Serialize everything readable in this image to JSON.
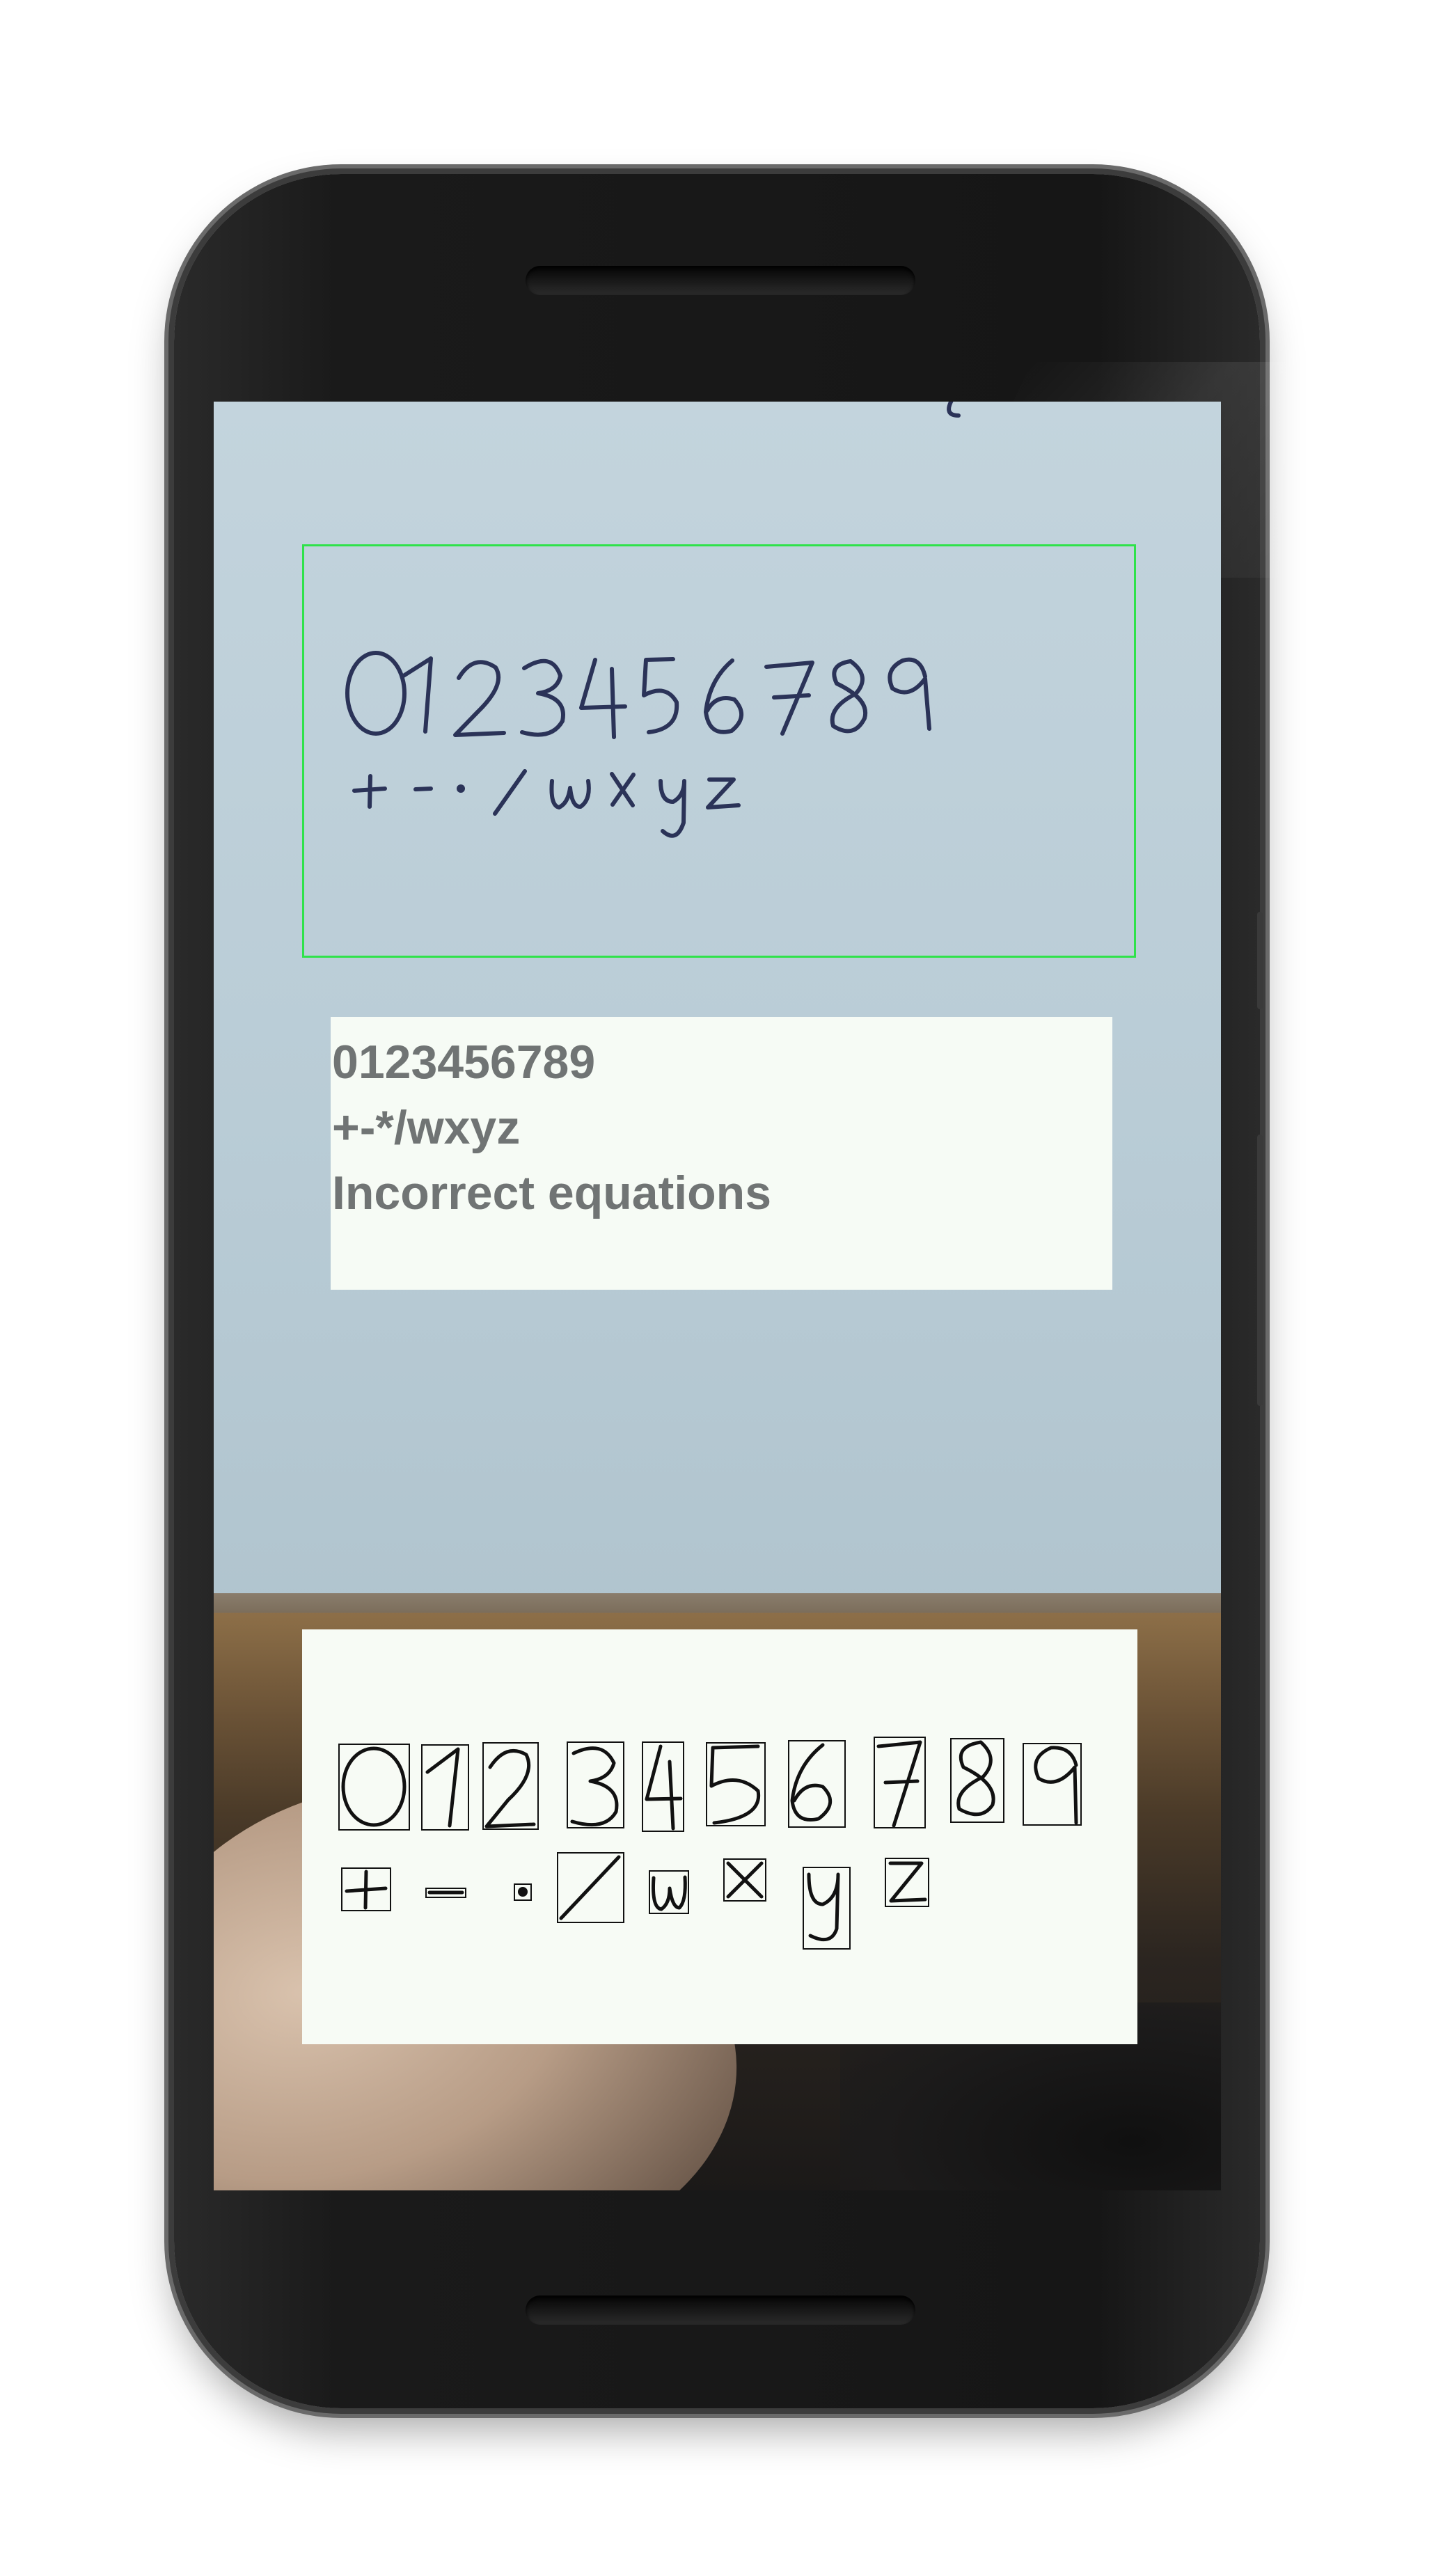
{
  "colors": {
    "detection_box": "#2fe24a",
    "result_text": "#707474",
    "ink": "#2b3358",
    "segment_ink": "#111111"
  },
  "handwritten_rows": [
    [
      "0",
      "1",
      "2",
      "3",
      "4",
      "5",
      "6",
      "7",
      "8",
      "9"
    ],
    [
      "+",
      "-",
      "·",
      "/",
      "w",
      "x",
      "y",
      "z"
    ]
  ],
  "recognition": {
    "lines": [
      "0123456789",
      "+-*/wxyz",
      "Incorrect equations"
    ]
  }
}
